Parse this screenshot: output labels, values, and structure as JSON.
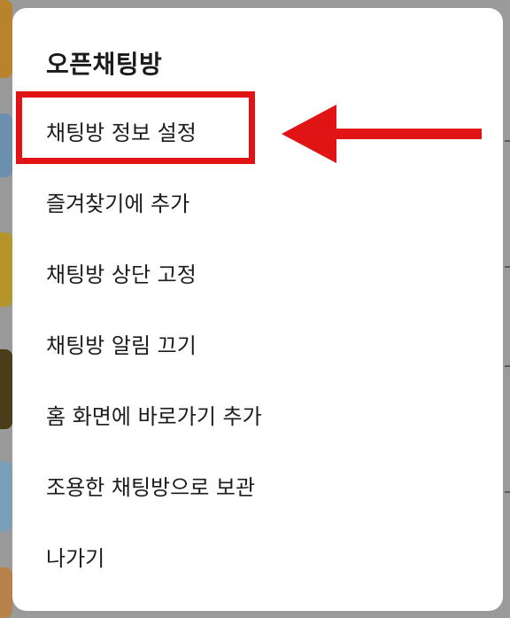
{
  "sheet": {
    "title": "오픈채팅방"
  },
  "menu": {
    "items": [
      {
        "label": "채팅방 정보 설정"
      },
      {
        "label": "즐겨찾기에 추가"
      },
      {
        "label": "채팅방 상단 고정"
      },
      {
        "label": "채팅방 알림 끄기"
      },
      {
        "label": "홈 화면에 바로가기 추가"
      },
      {
        "label": "조용한 채팅방으로 보관"
      },
      {
        "label": "나가기"
      }
    ]
  },
  "annotation": {
    "highlighted_item": "채팅방 정보 설정",
    "color": "#e01414"
  },
  "colors": {
    "sheet_background": "#ffffff",
    "text": "#1c1c1c",
    "dim_overlay": "#9a9a9a"
  }
}
